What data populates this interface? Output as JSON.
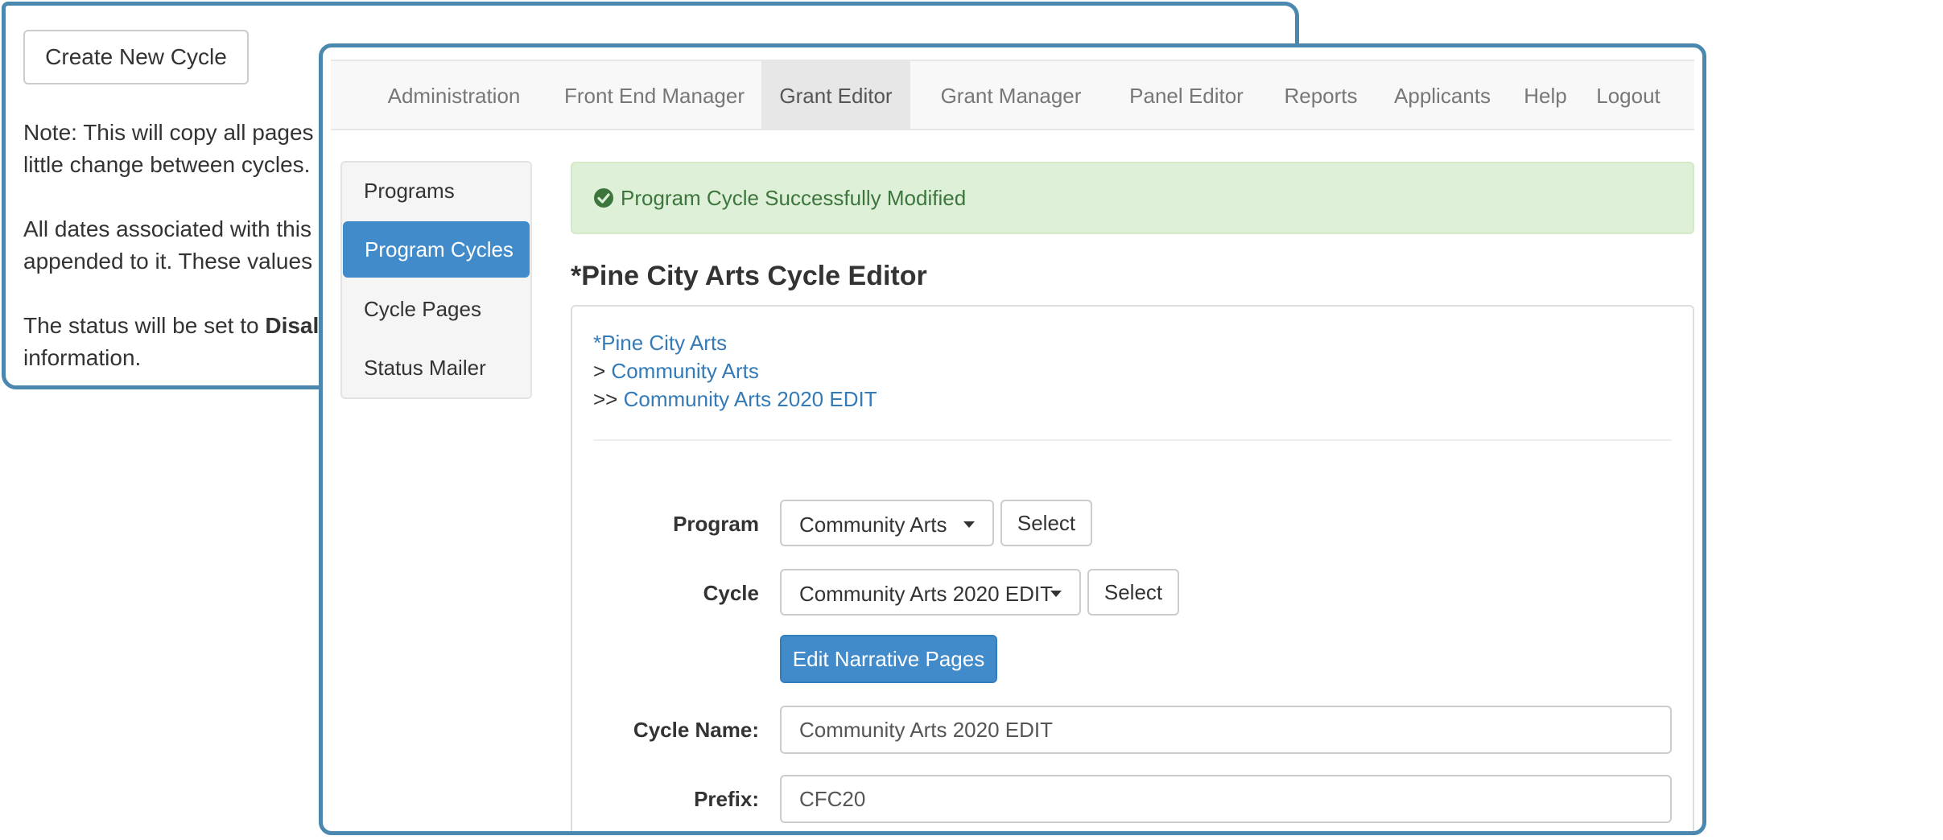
{
  "back_window": {
    "create_button": "Create New Cycle",
    "note_line1": "Note: This will copy all pages",
    "note_line2": "little change between cycles.",
    "dates_line1": "All dates associated with this",
    "dates_line2": "appended to it. These values",
    "status_prefix": "The status will be set to ",
    "status_bold": "Disal",
    "status_line2": "information."
  },
  "nav": {
    "items": [
      {
        "label": "Administration",
        "active": false
      },
      {
        "label": "Front End Manager",
        "active": false
      },
      {
        "label": "Grant Editor",
        "active": true
      },
      {
        "label": "Grant Manager",
        "active": false
      },
      {
        "label": "Panel Editor",
        "active": false
      },
      {
        "label": "Reports",
        "active": false
      },
      {
        "label": "Applicants",
        "active": false
      },
      {
        "label": "Help",
        "active": false
      },
      {
        "label": "Logout",
        "active": false
      }
    ]
  },
  "sidebar": {
    "items": [
      {
        "label": "Programs",
        "active": false
      },
      {
        "label": "Program Cycles",
        "active": true
      },
      {
        "label": "Cycle Pages",
        "active": false
      },
      {
        "label": "Status Mailer",
        "active": false
      }
    ]
  },
  "alert": {
    "message": "Program Cycle Successfully Modified",
    "icon": "check-circle-icon",
    "color": "#3c763d",
    "background": "#dff0d8"
  },
  "editor": {
    "title": "*Pine City Arts Cycle Editor",
    "breadcrumbs": [
      {
        "prefix": "",
        "label": "*Pine City Arts"
      },
      {
        "prefix": "> ",
        "label": "Community Arts"
      },
      {
        "prefix": ">> ",
        "label": "Community Arts 2020 EDIT"
      }
    ],
    "program_label": "Program",
    "program_value": "Community Arts",
    "program_select": "Select",
    "cycle_label": "Cycle",
    "cycle_value": "Community Arts 2020 EDIT",
    "cycle_select": "Select",
    "edit_narrative_button": "Edit Narrative Pages",
    "cycle_name_label": "Cycle Name:",
    "cycle_name_value": "Community Arts 2020 EDIT",
    "prefix_label": "Prefix:",
    "prefix_value": "CFC20"
  },
  "colors": {
    "primary": "#428bca",
    "link": "#337ab7",
    "window_border": "#4a88b0"
  }
}
